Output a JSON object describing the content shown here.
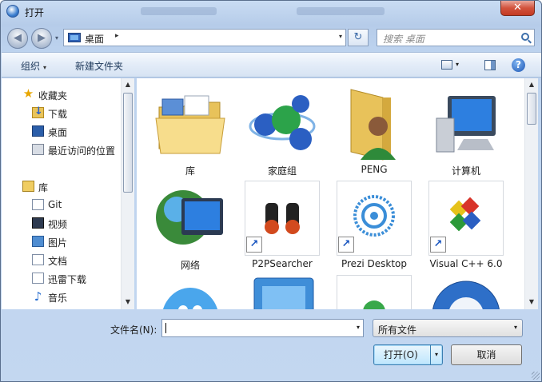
{
  "window": {
    "title": "打开",
    "close_glyph": "✕"
  },
  "address": {
    "location": "桌面",
    "separator": "▸",
    "search_placeholder": "搜索 桌面",
    "back_glyph": "◀",
    "forward_glyph": "▶",
    "refresh_glyph": "↻",
    "dropdown_glyph": "▾"
  },
  "toolbar": {
    "organize": "组织",
    "new_folder": "新建文件夹",
    "help_glyph": "?"
  },
  "nav": {
    "items": [
      {
        "label": "收藏夹",
        "icon": "star-icon",
        "glyph": "★"
      },
      {
        "label": "下载",
        "icon": "download-folder-icon",
        "glyph": ""
      },
      {
        "label": "桌面",
        "icon": "desktop-icon",
        "glyph": ""
      },
      {
        "label": "最近访问的位置",
        "icon": "recent-places-icon",
        "glyph": ""
      },
      {
        "label": "库",
        "icon": "library-icon",
        "glyph": ""
      },
      {
        "label": "Git",
        "icon": "git-library-icon",
        "glyph": ""
      },
      {
        "label": "视频",
        "icon": "video-library-icon",
        "glyph": ""
      },
      {
        "label": "图片",
        "icon": "pictures-library-icon",
        "glyph": ""
      },
      {
        "label": "文档",
        "icon": "documents-library-icon",
        "glyph": ""
      },
      {
        "label": "迅雷下载",
        "icon": "xunlei-download-icon",
        "glyph": ""
      },
      {
        "label": "音乐",
        "icon": "music-library-icon",
        "glyph": "♪"
      }
    ]
  },
  "content": {
    "items": [
      {
        "name": "库",
        "icon": "library-folder-icon"
      },
      {
        "name": "家庭组",
        "icon": "homegroup-icon"
      },
      {
        "name": "PENG",
        "icon": "user-folder-icon"
      },
      {
        "name": "计算机",
        "icon": "computer-icon"
      },
      {
        "name": "网络",
        "icon": "network-icon"
      },
      {
        "name": "P2PSearcher",
        "icon": "binoculars-icon"
      },
      {
        "name": "Prezi Desktop",
        "icon": "prezi-icon"
      },
      {
        "name": "Visual C++ 6.0",
        "icon": "visual-cpp-icon"
      }
    ],
    "shortcut_glyph": "↗"
  },
  "footer": {
    "filename_label": "文件名(N):",
    "filename_value": "",
    "filetype_value": "所有文件",
    "open_label": "打开(O)",
    "cancel_label": "取消"
  },
  "scroll": {
    "up_glyph": "▲",
    "down_glyph": "▼"
  }
}
